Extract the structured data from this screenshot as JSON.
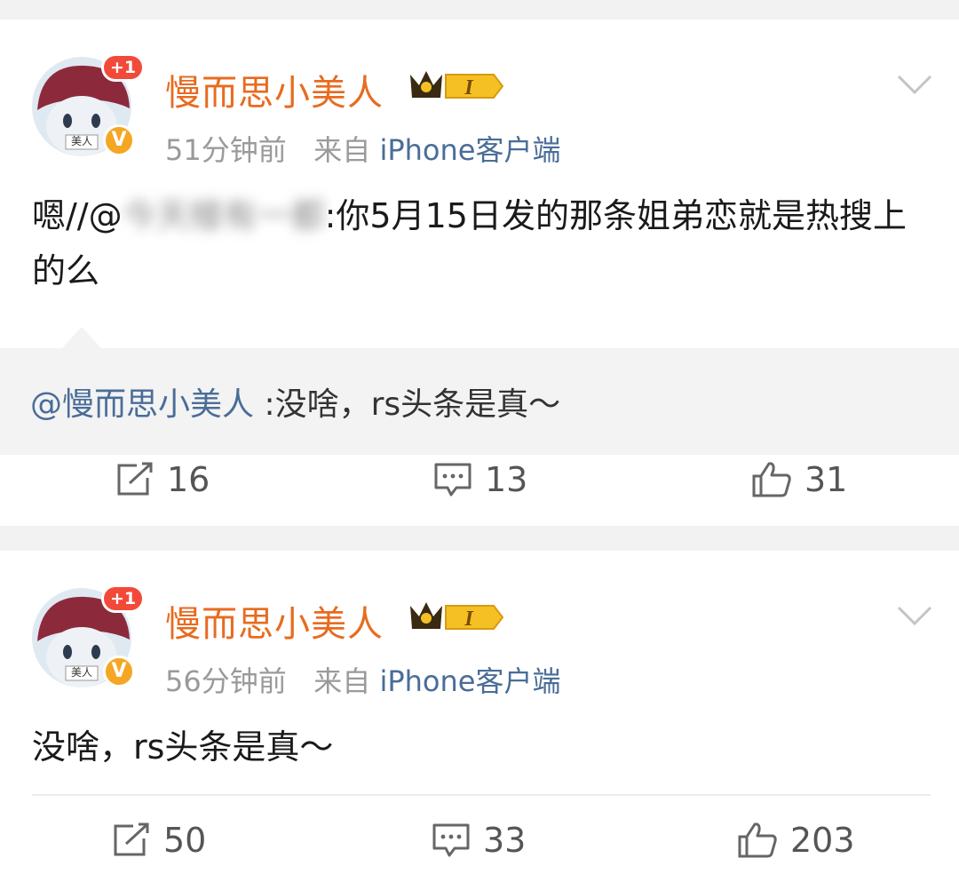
{
  "posts": [
    {
      "avatar_badge": "+1",
      "avatar_caption": "美人",
      "verified_mark": "V",
      "username": "慢而思小美人",
      "vip_level": "I",
      "time": "51分钟前",
      "source_prefix": "来自",
      "source": "iPhone客户端",
      "content_start": "嗯//@",
      "content_blurred": "今天楼有一都",
      "content_end": ":你5月15日发的那条姐弟恋就是热搜上的么",
      "quote_mention": "@慢而思小美人",
      "quote_text": " :没啥，rs头条是真～",
      "actions": {
        "repost": "16",
        "comment": "13",
        "like": "31"
      }
    },
    {
      "avatar_badge": "+1",
      "avatar_caption": "美人",
      "verified_mark": "V",
      "username": "慢而思小美人",
      "vip_level": "I",
      "time": "56分钟前",
      "source_prefix": "来自",
      "source": "iPhone客户端",
      "content": "没啥，rs头条是真～",
      "actions": {
        "repost": "50",
        "comment": "33",
        "like": "203"
      }
    }
  ],
  "colors": {
    "username": "#e86b1f",
    "source": "#4a6d98",
    "meta": "#9a9a9a",
    "badge": "#f24a3a",
    "verified": "#f5a623"
  },
  "icons": [
    "repost-icon",
    "comment-icon",
    "like-icon",
    "chevron-down-icon",
    "vip-crown-icon"
  ]
}
